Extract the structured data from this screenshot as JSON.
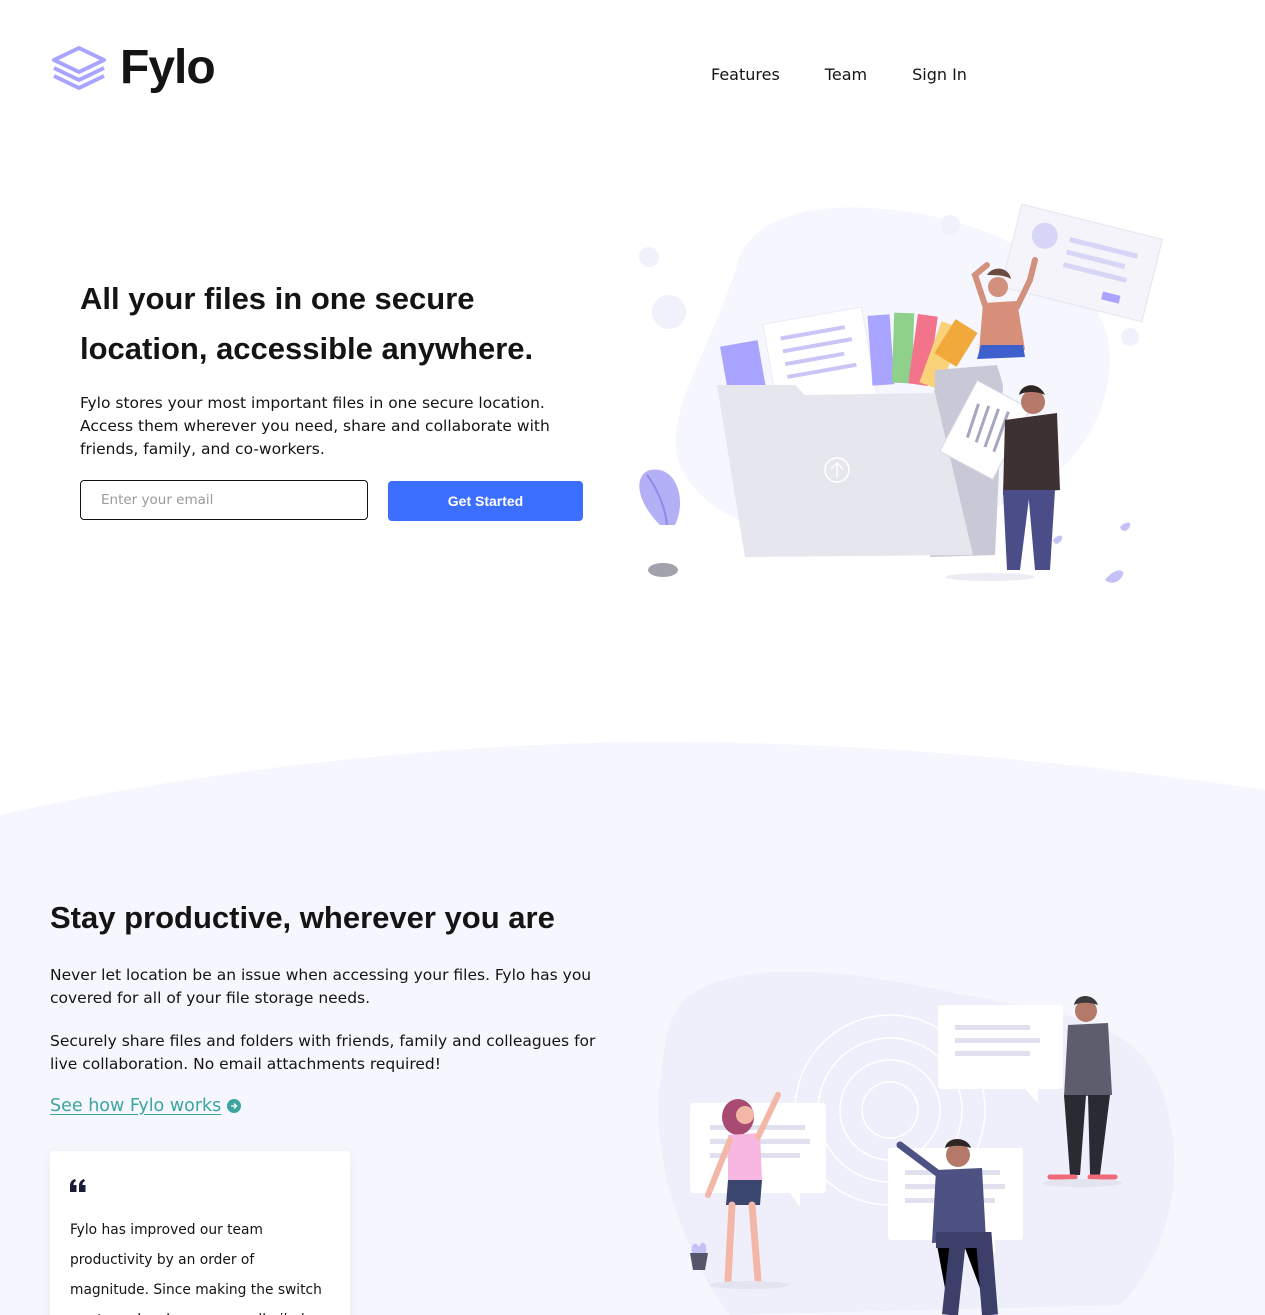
{
  "header": {
    "brand": "Fylo",
    "nav": [
      "Features",
      "Team",
      "Sign In"
    ]
  },
  "hero": {
    "title": "All your files in one secure location, accessible anywhere.",
    "description": "Fylo stores your most important files in one secure location. Access them wherever you need, share and collaborate with friends, family, and co-workers.",
    "email_placeholder": "Enter your email",
    "cta_label": "Get Started"
  },
  "productive": {
    "title": "Stay productive, wherever you are",
    "paragraph1": "Never let location be an issue when accessing your files. Fylo has you covered for all of your file storage needs.",
    "paragraph2": "Securely share files and folders with friends, family and colleagues for live collaboration. No email attachments required!",
    "link_label": "See how Fylo works",
    "testimonial": "Fylo has improved our team productivity by an order of magnitude. Since making the switch our team has become a well-oiled collaboration machine."
  },
  "colors": {
    "accent": "#3c6eff",
    "link": "#3ca59f",
    "logo": "#a8a4ff",
    "section_bg": "#f5f6fe",
    "text": "#141414"
  },
  "icons": [
    "logo-icon",
    "arrow-up-icon",
    "arrow-right-icon",
    "quote-icon"
  ]
}
